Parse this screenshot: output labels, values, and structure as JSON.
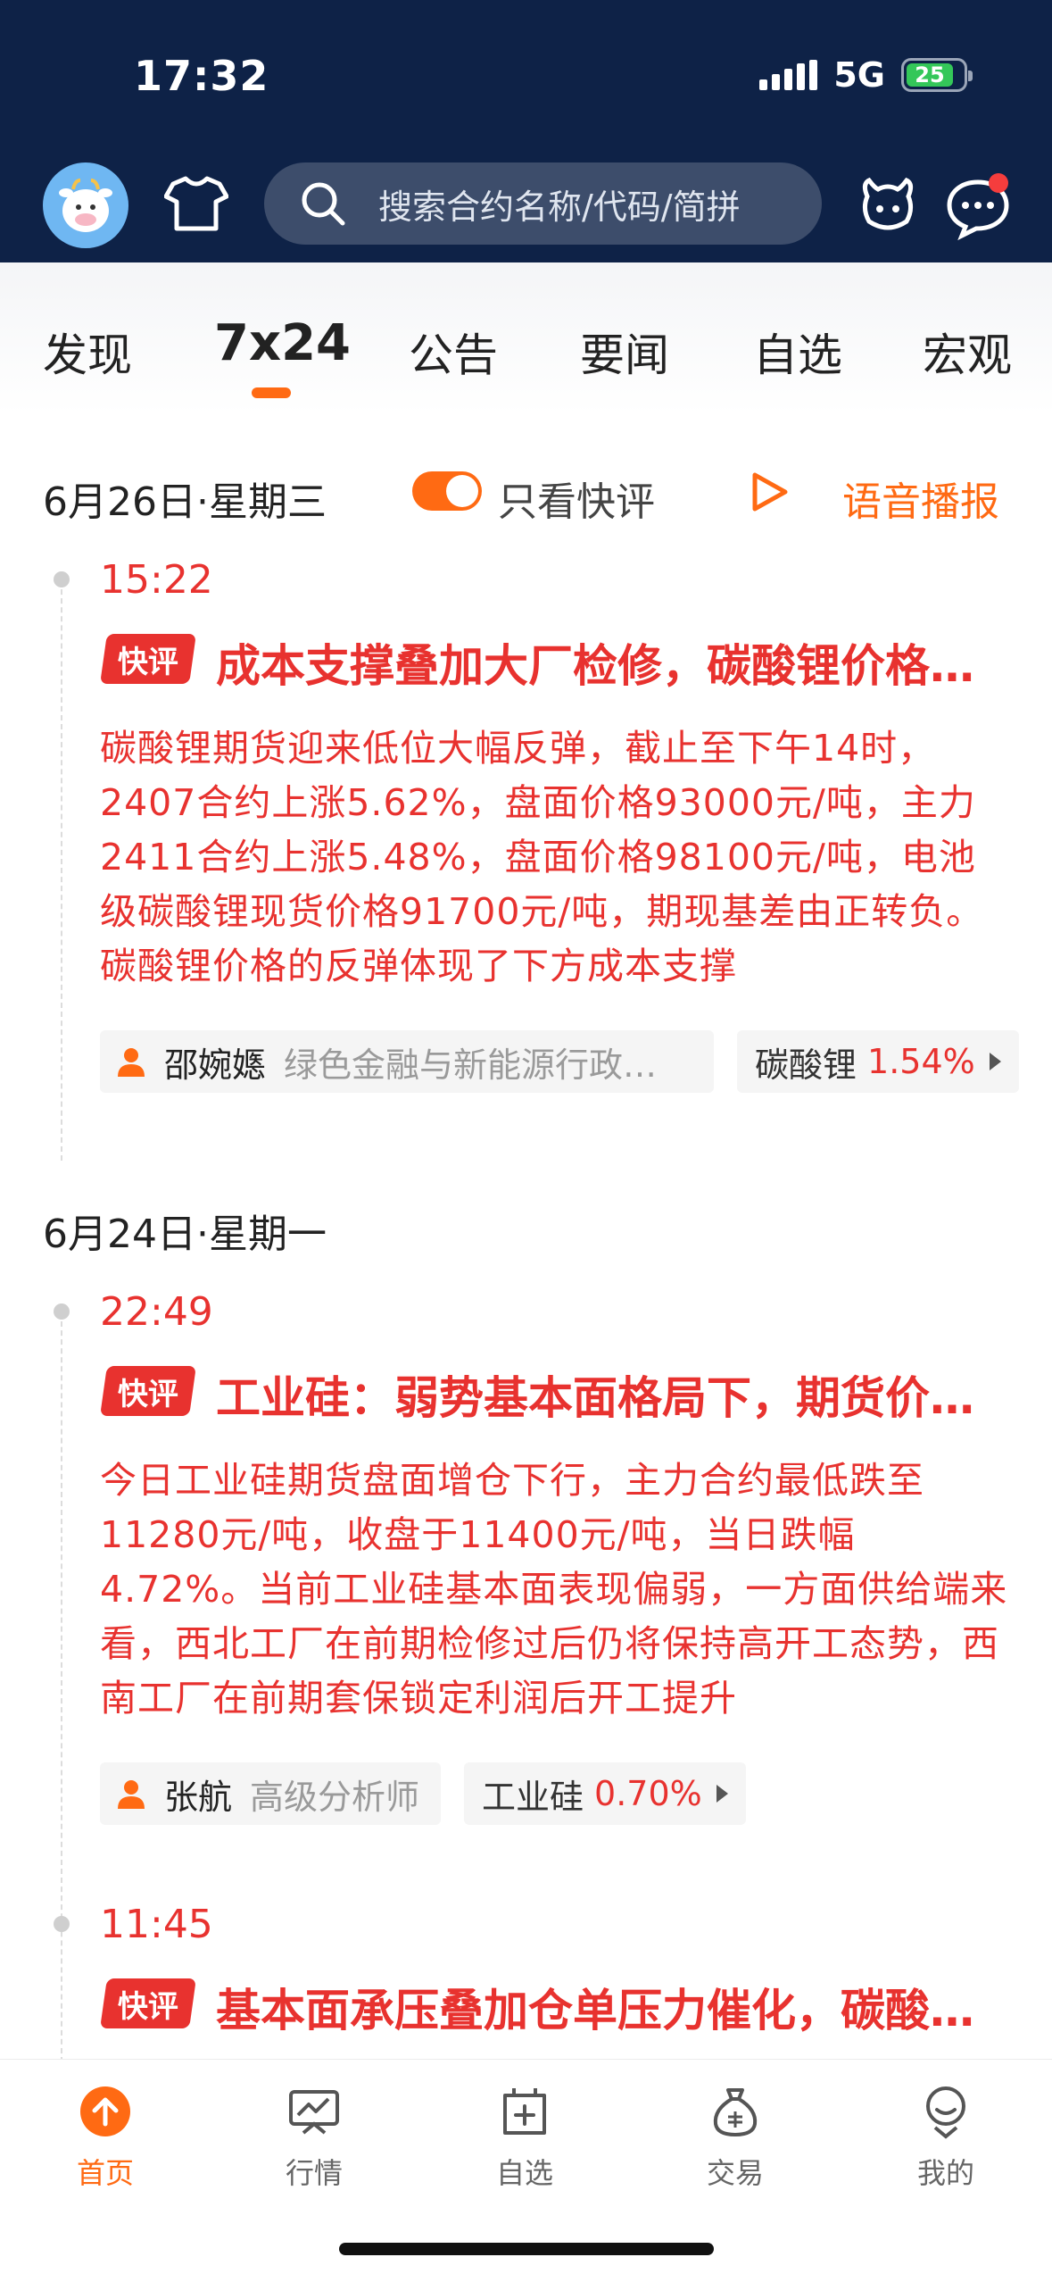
{
  "status_bar": {
    "time": "17:32",
    "network": "5G",
    "battery": "25"
  },
  "header": {
    "search_placeholder": "搜索合约名称/代码/简拼"
  },
  "tabs": [
    {
      "label": "发现"
    },
    {
      "label": "7x24",
      "active": true
    },
    {
      "label": "公告"
    },
    {
      "label": "要闻"
    },
    {
      "label": "自选"
    },
    {
      "label": "宏观"
    }
  ],
  "feed_controls": {
    "toggle_label": "只看快评",
    "toggle_on": true,
    "voice_label": "语音播报"
  },
  "sections": [
    {
      "date": "6月26日·星期三",
      "items": [
        {
          "time": "15:22",
          "tag": "快评",
          "headline": "成本支撑叠加大厂检修，碳酸锂价格反弹",
          "body": "碳酸锂期货迎来低位大幅反弹，截止至下午14时，2407合约上涨5.62%，盘面价格93000元/吨，主力2411合约上涨5.48%，盘面价格98100元/吨，电池级碳酸锂现货价格91700元/吨，期现基差由正转负。碳酸锂价格的反弹体现了下方成本支撑",
          "author": "邵婉嫕",
          "author_title": "绿色金融与新能源行政研究员",
          "quote_name": "碳酸锂",
          "quote_pct": "1.54%"
        }
      ]
    },
    {
      "date": "6月24日·星期一",
      "items": [
        {
          "time": "22:49",
          "tag": "快评",
          "headline": "工业硅：弱势基本面格局下，期货价格承压",
          "body": "今日工业硅期货盘面增仓下行，主力合约最低跌至11280元/吨，收盘于11400元/吨，当日跌幅4.72%。当前工业硅基本面表现偏弱，一方面供给端来看，西北工厂在前期检修过后仍将保持高开工态势，西南工厂在前期套保锁定利润后开工提升",
          "author": "张航",
          "author_title": "高级分析师",
          "quote_name": "工业硅",
          "quote_pct": "0.70%"
        },
        {
          "time": "11:45",
          "tag": "快评",
          "headline": "基本面承压叠加仓单压力催化，碳酸锂价格下行"
        }
      ]
    }
  ],
  "bottom_nav": [
    {
      "label": "首页",
      "icon": "home-arrow-icon",
      "active": true
    },
    {
      "label": "行情",
      "icon": "chart-icon"
    },
    {
      "label": "自选",
      "icon": "add-favorite-icon"
    },
    {
      "label": "交易",
      "icon": "money-bag-icon"
    },
    {
      "label": "我的",
      "icon": "profile-icon"
    }
  ],
  "colors": {
    "header_bg": "#0e2247",
    "accent": "#ff6a13",
    "news_red": "#e8322f"
  }
}
